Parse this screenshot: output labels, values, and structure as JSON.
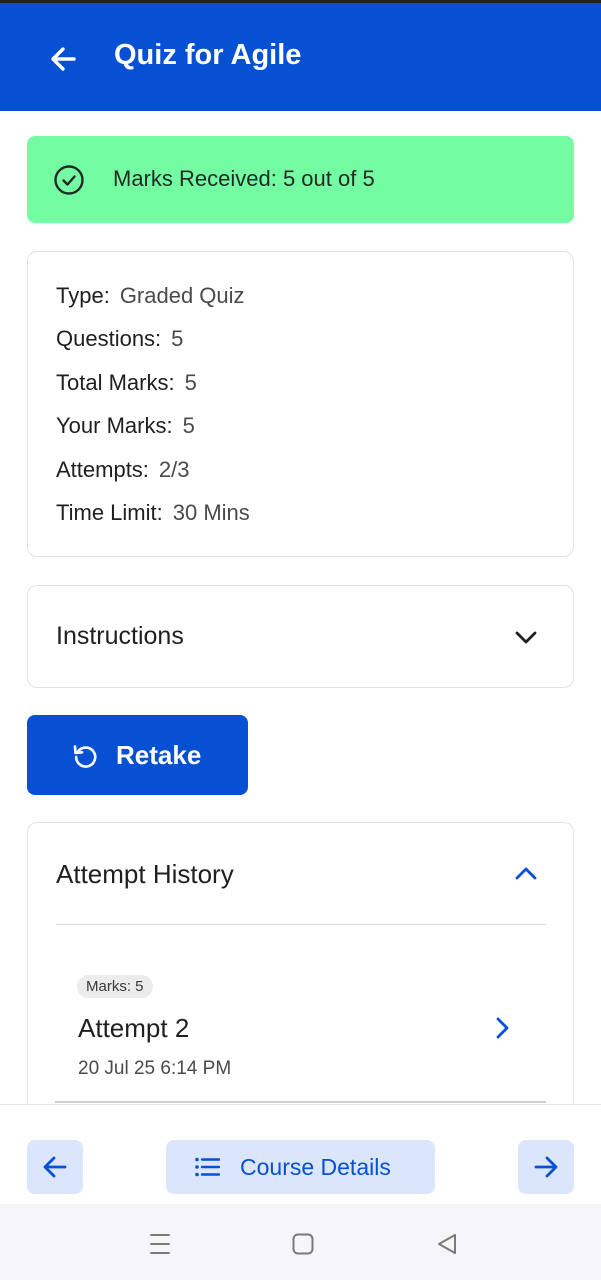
{
  "header": {
    "title": "Quiz for Agile",
    "back_icon": "arrow-left-icon",
    "background": "#0651d3"
  },
  "marks_banner": {
    "text": "Marks Received: 5 out of 5",
    "icon": "check-circle-icon",
    "background": "#74fca3"
  },
  "quiz_info": {
    "type_label": "Type:",
    "type_value": "Graded Quiz",
    "questions_label": "Questions:",
    "questions_value": "5",
    "total_marks_label": "Total Marks:",
    "total_marks_value": "5",
    "your_marks_label": "Your Marks:",
    "your_marks_value": "5",
    "attempts_label": "Attempts:",
    "attempts_value": "2/3",
    "time_limit_label": "Time Limit:",
    "time_limit_value": "30 Mins"
  },
  "instructions": {
    "label": "Instructions",
    "icon": "chevron-down-icon"
  },
  "retake_button": {
    "label": "Retake",
    "icon": "retake-icon"
  },
  "attempt_history": {
    "label": "Attempt History",
    "icon": "chevron-up-icon",
    "attempts": [
      {
        "badge": "Marks: 5",
        "name": "Attempt 2",
        "date": "20 Jul 25 6:14 PM",
        "icon": "chevron-right-icon"
      }
    ]
  },
  "bottom_nav": {
    "prev_icon": "arrow-left-icon",
    "course_details_label": "Course Details",
    "course_details_icon": "list-icon",
    "next_icon": "arrow-right-icon"
  },
  "system_nav": {
    "recents_icon": "recents-icon",
    "home_icon": "home-icon",
    "back_icon": "back-triangle-icon"
  }
}
